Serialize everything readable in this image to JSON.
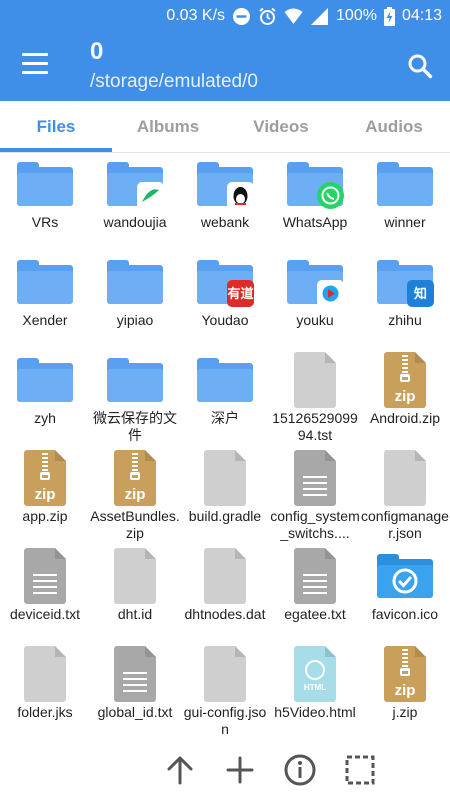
{
  "status": {
    "speed": "0.03 K/s",
    "battery": "100%",
    "time": "04:13"
  },
  "header": {
    "item_count": "0",
    "path": "/storage/emulated/0"
  },
  "tabs": [
    {
      "label": "Files"
    },
    {
      "label": "Albums"
    },
    {
      "label": "Videos"
    },
    {
      "label": "Audios"
    }
  ],
  "files": [
    {
      "name": "VRs",
      "type": "folder"
    },
    {
      "name": "wandoujia",
      "type": "folder",
      "badge": "wandoujia-icon",
      "badge_color": "#ffffff"
    },
    {
      "name": "webank",
      "type": "folder",
      "badge": "qq-penguin-icon",
      "badge_color": "#ffffff"
    },
    {
      "name": "WhatsApp",
      "type": "folder",
      "badge": "whatsapp-icon",
      "badge_color": "#25d366"
    },
    {
      "name": "winner",
      "type": "folder"
    },
    {
      "name": "Xender",
      "type": "folder"
    },
    {
      "name": "yipiao",
      "type": "folder"
    },
    {
      "name": "Youdao",
      "type": "folder",
      "badge": "youdao-icon",
      "badge_color": "#e02a2a",
      "badge_text": "有道"
    },
    {
      "name": "youku",
      "type": "folder",
      "badge": "youku-icon",
      "badge_color": "#ffffff"
    },
    {
      "name": "zhihu",
      "type": "folder",
      "badge": "zhihu-icon",
      "badge_color": "#1e80d8",
      "badge_text": "知"
    },
    {
      "name": "zyh",
      "type": "folder"
    },
    {
      "name": "微云保存的文件",
      "type": "folder"
    },
    {
      "name": "深户",
      "type": "folder"
    },
    {
      "name": "1512652909994.tst",
      "type": "plain"
    },
    {
      "name": "Android.zip",
      "type": "zip"
    },
    {
      "name": "app.zip",
      "type": "zip"
    },
    {
      "name": "AssetBundles.zip",
      "type": "zip"
    },
    {
      "name": "build.gradle",
      "type": "plain"
    },
    {
      "name": "config_system_switchs....",
      "type": "text"
    },
    {
      "name": "configmanager.json",
      "type": "plain"
    },
    {
      "name": "deviceid.txt",
      "type": "text"
    },
    {
      "name": "dht.id",
      "type": "plain"
    },
    {
      "name": "dhtnodes.dat",
      "type": "plain"
    },
    {
      "name": "egatee.txt",
      "type": "text"
    },
    {
      "name": "favicon.ico",
      "type": "icofolder"
    },
    {
      "name": "folder.jks",
      "type": "plain"
    },
    {
      "name": "global_id.txt",
      "type": "text"
    },
    {
      "name": "gui-config.json",
      "type": "plain"
    },
    {
      "name": "h5Video.html",
      "type": "html"
    },
    {
      "name": "j.zip",
      "type": "zip"
    }
  ],
  "zip_label": "zip",
  "html_label": "HTML",
  "colors": {
    "accent": "#3f8ee8",
    "folder": "#6eaef5",
    "zip": "#c9a05b"
  },
  "bottom_actions": [
    {
      "icon": "arrow-up-icon"
    },
    {
      "icon": "plus-icon"
    },
    {
      "icon": "info-icon"
    },
    {
      "icon": "select-all-icon"
    }
  ]
}
